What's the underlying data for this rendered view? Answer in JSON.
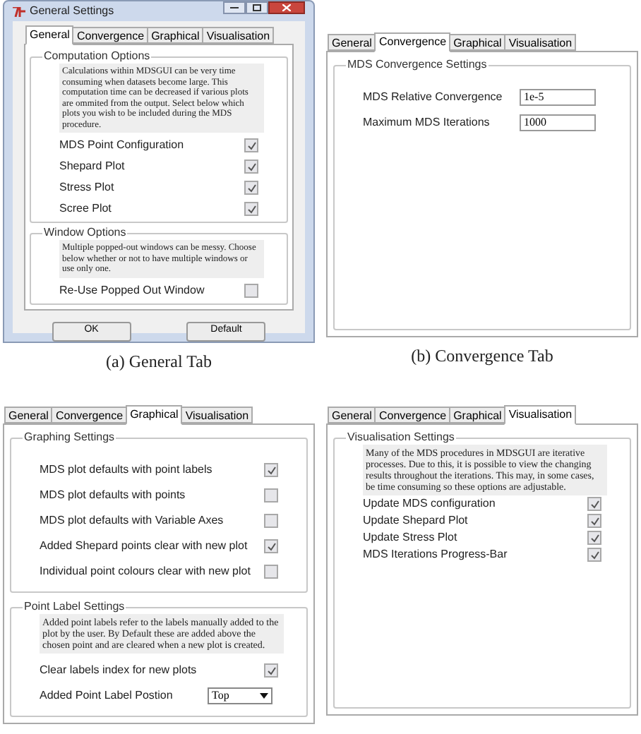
{
  "panels": [
    {
      "window_title": "General Settings",
      "tabs": [
        {
          "label": "General",
          "selected": true
        },
        {
          "label": "Convergence",
          "selected": false
        },
        {
          "label": "Graphical",
          "selected": false
        },
        {
          "label": "Visualisation",
          "selected": false
        }
      ],
      "groups": [
        {
          "title": "Computation Options",
          "note": "Calculations within MDSGUI can be very time consuming when datasets become large. This computation time can be decreased if various plots are ommited from the output. Select below which plots you wish to be included during the MDS procedure.",
          "rows": [
            {
              "kind": "checkbox",
              "label": "MDS Point Configuration",
              "checked": true
            },
            {
              "kind": "checkbox",
              "label": "Shepard Plot",
              "checked": true
            },
            {
              "kind": "checkbox",
              "label": "Stress Plot",
              "checked": true
            },
            {
              "kind": "checkbox",
              "label": "Scree Plot",
              "checked": true
            }
          ]
        },
        {
          "title": "Window Options",
          "note": "Multiple popped-out windows can be messy. Choose below whether or not to have multiple windows or use only one.",
          "rows": [
            {
              "kind": "checkbox",
              "label": "Re-Use Popped Out Window",
              "checked": false
            }
          ]
        }
      ],
      "buttons": [
        "OK",
        "Default"
      ],
      "caption": "(a) General Tab"
    },
    {
      "tabs": [
        {
          "label": "General",
          "selected": false
        },
        {
          "label": "Convergence",
          "selected": true
        },
        {
          "label": "Graphical",
          "selected": false
        },
        {
          "label": "Visualisation",
          "selected": false
        }
      ],
      "groups": [
        {
          "title": "MDS Convergence Settings",
          "rows": [
            {
              "kind": "field",
              "label": "MDS Relative Convergence",
              "value": "1e-5"
            },
            {
              "kind": "field",
              "label": "Maximum MDS Iterations",
              "value": "1000"
            }
          ]
        }
      ],
      "caption": "(b) Convergence Tab"
    },
    {
      "tabs": [
        {
          "label": "General",
          "selected": false
        },
        {
          "label": "Convergence",
          "selected": false
        },
        {
          "label": "Graphical",
          "selected": true
        },
        {
          "label": "Visualisation",
          "selected": false
        }
      ],
      "groups": [
        {
          "title": "Graphing Settings",
          "rows": [
            {
              "kind": "checkbox",
              "label": "MDS plot defaults with point labels",
              "checked": true
            },
            {
              "kind": "checkbox",
              "label": "MDS plot defaults with points",
              "checked": false
            },
            {
              "kind": "checkbox",
              "label": "MDS plot defaults with Variable Axes",
              "checked": false
            },
            {
              "kind": "checkbox",
              "label": "Added Shepard points clear with new plot",
              "checked": true
            },
            {
              "kind": "checkbox",
              "label": "Individual point colours clear with new plot",
              "checked": false
            }
          ]
        },
        {
          "title": "Point Label Settings",
          "note": "Added point labels refer to the labels manually added to the plot by the user. By Default these are added above the chosen point and are cleared when a new plot is created.",
          "rows": [
            {
              "kind": "checkbox",
              "label": "Clear labels index for new plots",
              "checked": true
            },
            {
              "kind": "select",
              "label": "Added Point Label Postion",
              "value": "Top"
            }
          ]
        }
      ]
    },
    {
      "tabs": [
        {
          "label": "General",
          "selected": false
        },
        {
          "label": "Convergence",
          "selected": false
        },
        {
          "label": "Graphical",
          "selected": false
        },
        {
          "label": "Visualisation",
          "selected": true
        }
      ],
      "groups": [
        {
          "title": "Visualisation Settings",
          "note": "Many of the MDS procedures in MDSGUI are iterative processes. Due to this, it is possible to view the changing results throughout the iterations. This may, in some cases, be time consuming so these options are adjustable.",
          "rows": [
            {
              "kind": "checkbox",
              "label": "Update MDS configuration",
              "checked": true
            },
            {
              "kind": "checkbox",
              "label": "Update Shepard Plot",
              "checked": true
            },
            {
              "kind": "checkbox",
              "label": "Update Stress Plot",
              "checked": true
            },
            {
              "kind": "checkbox",
              "label": "MDS Iterations Progress-Bar",
              "checked": true
            }
          ]
        }
      ]
    }
  ]
}
